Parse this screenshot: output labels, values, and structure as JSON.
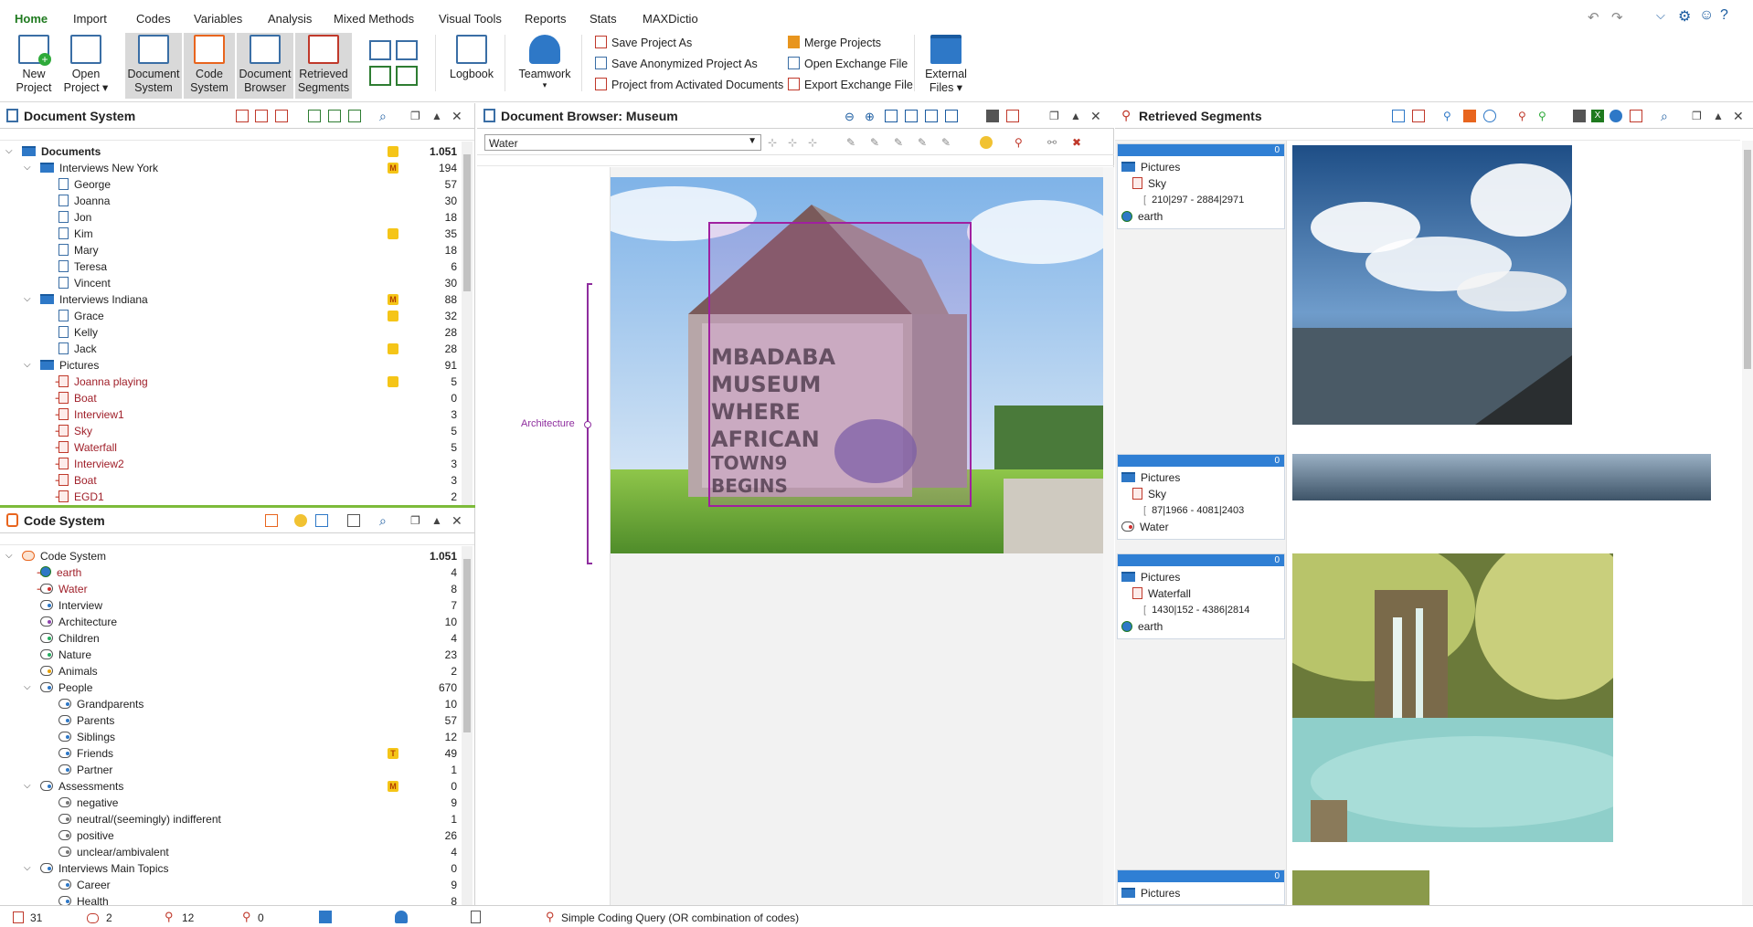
{
  "menu": {
    "tabs": [
      "Home",
      "Import",
      "Codes",
      "Variables",
      "Analysis",
      "Mixed Methods",
      "Visual Tools",
      "Reports",
      "Stats",
      "MAXDictio"
    ]
  },
  "ribbon": {
    "new_project": "New\nProject",
    "open_project": "Open\nProject ▾",
    "document_system": "Document\nSystem",
    "code_system": "Code\nSystem",
    "document_browser": "Document\nBrowser",
    "retrieved_segments": "Retrieved\nSegments",
    "logbook": "Logbook",
    "teamwork": "Teamwork",
    "teamwork_arrow": "▾",
    "save_project_as": "Save Project As",
    "save_anonymized": "Save Anonymized Project As",
    "project_from_activated": "Project from Activated Documents",
    "merge_projects": "Merge Projects",
    "open_exchange": "Open Exchange File",
    "export_exchange": "Export Exchange File",
    "external_files": "External\nFiles ▾"
  },
  "doc_system": {
    "title": "Document System",
    "rows": [
      {
        "label": "Documents",
        "count": "1.051",
        "bold": true,
        "level": 0,
        "icon": "folder",
        "badge": "memo",
        "arrow": "down"
      },
      {
        "label": "Interviews New York",
        "count": "194",
        "level": 1,
        "icon": "folder",
        "badge": "M",
        "arrow": "down"
      },
      {
        "label": "George",
        "count": "57",
        "level": 2,
        "icon": "doc"
      },
      {
        "label": "Joanna",
        "count": "30",
        "level": 2,
        "icon": "doc"
      },
      {
        "label": "Jon",
        "count": "18",
        "level": 2,
        "icon": "doc"
      },
      {
        "label": "Kim",
        "count": "35",
        "level": 2,
        "icon": "doc",
        "badge": "memo"
      },
      {
        "label": "Mary",
        "count": "18",
        "level": 2,
        "icon": "doc"
      },
      {
        "label": "Teresa",
        "count": "6",
        "level": 2,
        "icon": "doc"
      },
      {
        "label": "Vincent",
        "count": "30",
        "level": 2,
        "icon": "doc"
      },
      {
        "label": "Interviews Indiana",
        "count": "88",
        "level": 1,
        "icon": "folder",
        "badge": "M",
        "arrow": "down"
      },
      {
        "label": "Grace",
        "count": "32",
        "level": 2,
        "icon": "doc",
        "badge": "memo"
      },
      {
        "label": "Kelly",
        "count": "28",
        "level": 2,
        "icon": "doc"
      },
      {
        "label": "Jack",
        "count": "28",
        "level": 2,
        "icon": "doc",
        "badge": "memo"
      },
      {
        "label": "Pictures",
        "count": "91",
        "level": 1,
        "icon": "folder",
        "arrow": "down",
        "active": true
      },
      {
        "label": "Joanna playing",
        "count": "5",
        "level": 2,
        "icon": "pic",
        "red": true,
        "badge": "memo"
      },
      {
        "label": "Boat",
        "count": "0",
        "level": 2,
        "icon": "pic",
        "red": true
      },
      {
        "label": "Interview1",
        "count": "3",
        "level": 2,
        "icon": "pic",
        "red": true
      },
      {
        "label": "Sky",
        "count": "5",
        "level": 2,
        "icon": "pic",
        "red": true
      },
      {
        "label": "Waterfall",
        "count": "5",
        "level": 2,
        "icon": "pic",
        "red": true
      },
      {
        "label": "Interview2",
        "count": "3",
        "level": 2,
        "icon": "pic",
        "red": true
      },
      {
        "label": "Boat",
        "count": "3",
        "level": 2,
        "icon": "pic",
        "red": true
      },
      {
        "label": "EGD1",
        "count": "2",
        "level": 2,
        "icon": "pic",
        "red": true
      }
    ]
  },
  "code_system": {
    "title": "Code System",
    "rows": [
      {
        "label": "Code System",
        "count": "1.051",
        "level": 0,
        "icon": "cs",
        "arrow": "down"
      },
      {
        "label": "earth",
        "count": "4",
        "level": 1,
        "icon": "globe",
        "red": true
      },
      {
        "label": "Water",
        "count": "8",
        "level": 1,
        "icon": "code",
        "red": true,
        "dot": "#d03030"
      },
      {
        "label": "Interview",
        "count": "7",
        "level": 1,
        "icon": "code",
        "dot": "#2e78c7"
      },
      {
        "label": "Architecture",
        "count": "10",
        "level": 1,
        "icon": "code",
        "dot": "#8e44ad"
      },
      {
        "label": "Children",
        "count": "4",
        "level": 1,
        "icon": "code",
        "dot": "#27ae60"
      },
      {
        "label": "Nature",
        "count": "23",
        "level": 1,
        "icon": "code",
        "dot": "#27ae60"
      },
      {
        "label": "Animals",
        "count": "2",
        "level": 1,
        "icon": "code",
        "dot": "#e6a000"
      },
      {
        "label": "People",
        "count": "670",
        "level": 1,
        "icon": "code",
        "dot": "#2e78c7",
        "arrow": "down"
      },
      {
        "label": "Grandparents",
        "count": "10",
        "level": 2,
        "icon": "code",
        "dot": "#2e78c7"
      },
      {
        "label": "Parents",
        "count": "57",
        "level": 2,
        "icon": "code",
        "dot": "#2e78c7"
      },
      {
        "label": "Siblings",
        "count": "12",
        "level": 2,
        "icon": "code",
        "dot": "#2e78c7"
      },
      {
        "label": "Friends",
        "count": "49",
        "level": 2,
        "icon": "code",
        "dot": "#2e78c7",
        "badge": "T"
      },
      {
        "label": "Partner",
        "count": "1",
        "level": 2,
        "icon": "code",
        "dot": "#2e78c7"
      },
      {
        "label": "Assessments",
        "count": "0",
        "level": 1,
        "icon": "code",
        "dot": "#2e78c7",
        "arrow": "down",
        "badge": "M"
      },
      {
        "label": "negative",
        "count": "9",
        "level": 2,
        "icon": "code",
        "dot": "#777"
      },
      {
        "label": "neutral/(seemingly) indifferent",
        "count": "1",
        "level": 2,
        "icon": "code",
        "dot": "#777"
      },
      {
        "label": "positive",
        "count": "26",
        "level": 2,
        "icon": "code",
        "dot": "#777"
      },
      {
        "label": "unclear/ambivalent",
        "count": "4",
        "level": 2,
        "icon": "code",
        "dot": "#777"
      },
      {
        "label": "Interviews Main Topics",
        "count": "0",
        "level": 1,
        "icon": "code",
        "dot": "#2e78c7",
        "arrow": "down"
      },
      {
        "label": "Career",
        "count": "9",
        "level": 2,
        "icon": "code",
        "dot": "#2e78c7"
      },
      {
        "label": "Health",
        "count": "8",
        "level": 2,
        "icon": "code",
        "dot": "#2e78c7"
      }
    ]
  },
  "browser": {
    "title": "Document Browser: Museum",
    "code_select": "Water",
    "code_label": "Architecture"
  },
  "retrieved": {
    "title": "Retrieved Segments",
    "segments": [
      {
        "count": "0",
        "folder": "Pictures",
        "doc": "Sky",
        "coords": "210|297 - 2884|2971",
        "code": "earth",
        "code_icon": "globe"
      },
      {
        "count": "0",
        "folder": "Pictures",
        "doc": "Sky",
        "coords": "87|1966 - 4081|2403",
        "code": "Water",
        "code_icon": "code"
      },
      {
        "count": "0",
        "folder": "Pictures",
        "doc": "Waterfall",
        "coords": "1430|152 - 4386|2814",
        "code": "earth",
        "code_icon": "globe"
      },
      {
        "count": "0",
        "folder": "Pictures",
        "doc": "",
        "coords": "",
        "code": "",
        "code_icon": ""
      }
    ]
  },
  "status": {
    "docs": "31",
    "memos": "2",
    "codes": "12",
    "segments": "0",
    "query": "Simple Coding Query (OR combination of codes)"
  },
  "colors": {
    "accent": "#1f7a1f",
    "blue": "#2f7fd4",
    "red": "#c0392b",
    "purple": "#8e2d9e"
  }
}
